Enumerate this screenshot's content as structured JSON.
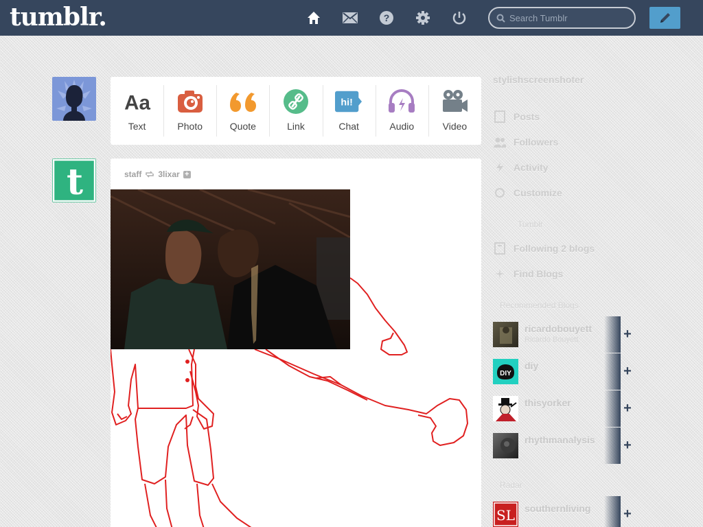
{
  "header": {
    "logo": "tumblr.",
    "search_placeholder": "Search Tumblr",
    "nav": [
      {
        "name": "home-icon"
      },
      {
        "name": "inbox-icon"
      },
      {
        "name": "help-icon"
      },
      {
        "name": "settings-icon"
      },
      {
        "name": "logout-icon"
      }
    ],
    "compose_icon": "pencil-icon"
  },
  "post_types": [
    {
      "label": "Text",
      "icon": "text-icon",
      "color": "#444444"
    },
    {
      "label": "Photo",
      "icon": "camera-icon",
      "color": "#d95e40"
    },
    {
      "label": "Quote",
      "icon": "quote-icon",
      "color": "#f2992e"
    },
    {
      "label": "Link",
      "icon": "link-icon",
      "color": "#56bc8a"
    },
    {
      "label": "Chat",
      "icon": "chat-icon",
      "color": "#529ecc"
    },
    {
      "label": "Audio",
      "icon": "headphones-icon",
      "color": "#a77dc2"
    },
    {
      "label": "Video",
      "icon": "video-camera-icon",
      "color": "#748089"
    }
  ],
  "post": {
    "author": "staff",
    "reblogged_from": "3lixar"
  },
  "sidebar": {
    "blog_name": "stylishscreenshoter",
    "items": [
      {
        "label": "Posts",
        "icon": "posts-icon"
      },
      {
        "label": "Followers",
        "icon": "followers-icon"
      },
      {
        "label": "Activity",
        "icon": "activity-icon"
      },
      {
        "label": "Customize",
        "icon": "customize-icon"
      }
    ],
    "section2_head": "Tumblr",
    "items2": [
      {
        "label": "Following 2 blogs",
        "icon": "following-icon"
      },
      {
        "label": "Find Blogs",
        "icon": "find-blogs-icon"
      }
    ],
    "rec_head": "Recommended Blogs",
    "recommended": [
      {
        "name": "ricardobouyett",
        "sub": "Ricardo Bouyett"
      },
      {
        "name": "diy",
        "sub": ""
      },
      {
        "name": "thisyorker",
        "sub": ""
      },
      {
        "name": "rhythmanalysis",
        "sub": ""
      }
    ],
    "radar_head": "Radar",
    "radar": [
      {
        "name": "southernliving",
        "sub": ""
      }
    ]
  }
}
